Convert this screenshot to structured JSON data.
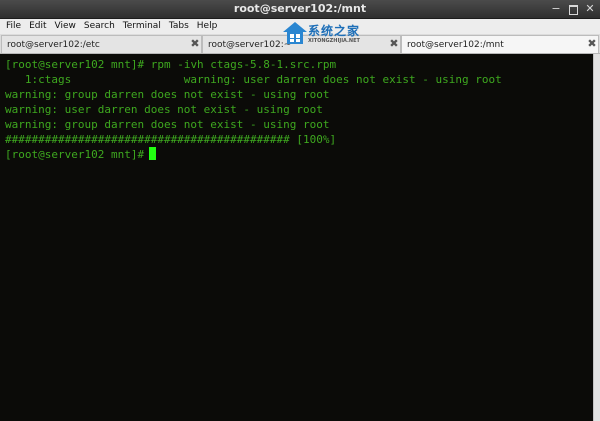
{
  "window": {
    "title": "root@server102:/mnt",
    "controls": {
      "minimize": "−",
      "close": "✕"
    }
  },
  "menu": [
    "File",
    "Edit",
    "View",
    "Search",
    "Terminal",
    "Tabs",
    "Help"
  ],
  "tabs": [
    {
      "label": "root@server102:/etc",
      "close": "✖"
    },
    {
      "label": "root@server102:~",
      "close": "✖"
    },
    {
      "label": "root@server102:/mnt",
      "close": "✖",
      "active": true
    }
  ],
  "watermark": {
    "name": "系统之家",
    "site": "XITONGZHIJIA.NET"
  },
  "terminal": {
    "prompt": "[root@server102 mnt]#",
    "command": "rpm -ivh ctags-5.8-1.src.rpm",
    "lines": [
      "   1:ctags                 warning: user darren does not exist - using root",
      "warning: group darren does not exist - using root",
      "warning: user darren does not exist - using root",
      "warning: group darren does not exist - using root",
      "########################################### [100%]"
    ],
    "final_prompt": "[root@server102 mnt]#",
    "colors": {
      "background": "#0b0b08",
      "text": "#3ea81f",
      "cursor": "#22ff11"
    }
  }
}
